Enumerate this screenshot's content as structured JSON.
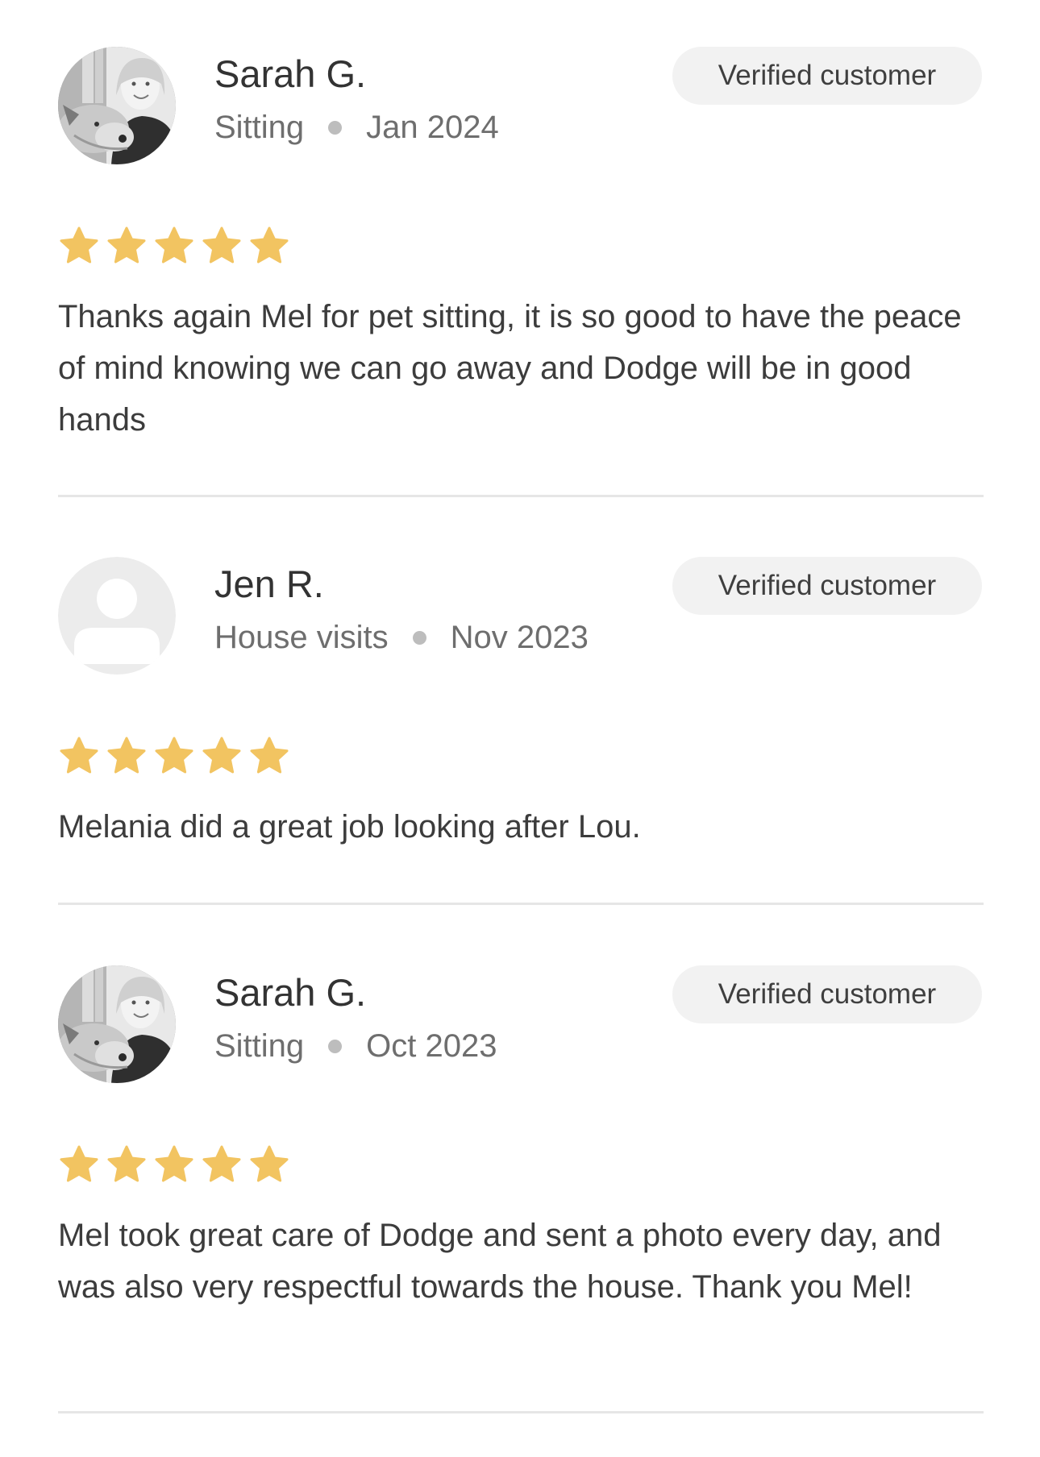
{
  "reviews": [
    {
      "reviewer_name": "Sarah G.",
      "service": "Sitting",
      "date": "Jan 2024",
      "badge": "Verified customer",
      "rating": 5,
      "avatar": "photo-avatar",
      "text": "Thanks again Mel for pet sitting, it is so good to have the peace of mind knowing we can go away and Dodge will be in good hands"
    },
    {
      "reviewer_name": "Jen R.",
      "service": "House visits",
      "date": "Nov 2023",
      "badge": "Verified customer",
      "rating": 5,
      "avatar": "default-user-avatar",
      "text": "Melania did a great job looking after Lou."
    },
    {
      "reviewer_name": "Sarah G.",
      "service": "Sitting",
      "date": "Oct 2023",
      "badge": "Verified customer",
      "rating": 5,
      "avatar": "photo-avatar",
      "text": "Mel took great care of Dodge and sent a photo every day, and was also very respectful towards the house. Thank you Mel!"
    }
  ],
  "colors": {
    "star": "#F2C461",
    "badge_bg": "#F2F2F2",
    "divider": "#E6E6E6",
    "text": "#3C3C3C",
    "meta": "#6E6E6E"
  }
}
